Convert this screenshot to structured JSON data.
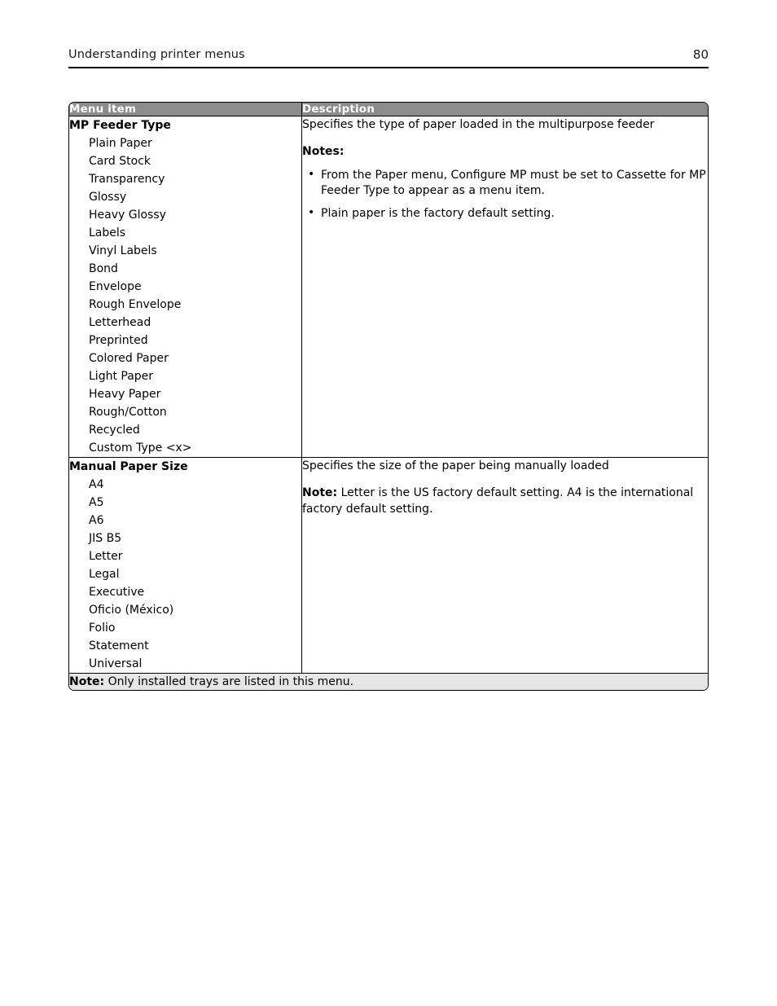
{
  "page": {
    "header_title": "Understanding printer menus",
    "page_number": "80"
  },
  "table": {
    "columns": [
      "Menu item",
      "Description"
    ],
    "rows": [
      {
        "menu_item_title": "MP Feeder Type",
        "options": [
          "Plain Paper",
          "Card Stock",
          "Transparency",
          "Glossy",
          "Heavy Glossy",
          "Labels",
          "Vinyl Labels",
          "Bond",
          "Envelope",
          "Rough Envelope",
          "Letterhead",
          "Preprinted",
          "Colored Paper",
          "Light Paper",
          "Heavy Paper",
          "Rough/Cotton",
          "Recycled",
          "Custom Type <x>"
        ],
        "description_intro": "Specifies the type of paper loaded in the multipurpose feeder",
        "notes_label": "Notes:",
        "notes": [
          "From the Paper menu, Configure MP must be set to Cassette for MP Feeder Type to appear as a menu item.",
          "Plain paper is the factory default setting."
        ]
      },
      {
        "menu_item_title": "Manual Paper Size",
        "options": [
          "A4",
          "A5",
          "A6",
          "JIS B5",
          "Letter",
          "Legal",
          "Executive",
          "Oficio (México)",
          "Folio",
          "Statement",
          "Universal"
        ],
        "description_intro": "Specifies the size of the paper being manually loaded",
        "note_label": "Note:",
        "note_text": "Letter is the US factory default setting. A4 is the international factory default setting."
      }
    ],
    "footnote": {
      "label": "Note:",
      "text": "Only installed trays are listed in this menu."
    }
  },
  "colors": {
    "header_fill": "#8c8c8c",
    "header_text": "#ffffff",
    "footnote_fill": "#e6e6e6",
    "border": "#000000",
    "page_background": "#ffffff"
  }
}
